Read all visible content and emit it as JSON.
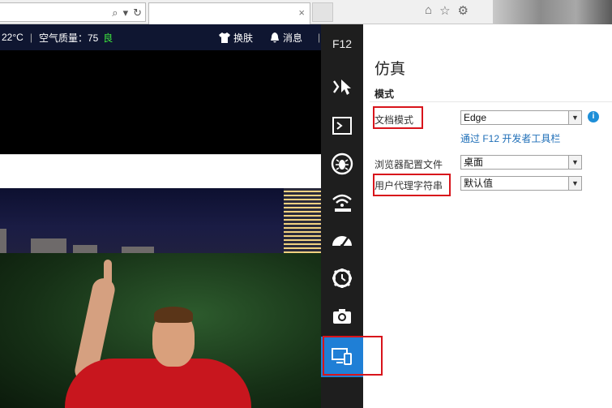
{
  "browser": {
    "tab_close": "×",
    "toolbar_icons": [
      "⌕",
      "▾",
      "↻"
    ],
    "right_icons": [
      "⌂",
      "☆",
      "⚙"
    ]
  },
  "page": {
    "weather": "22°C",
    "separator": "|",
    "air_quality_label": "空气质量：75",
    "air_quality_level": "良",
    "skin_label": "换肤",
    "message_label": "消息",
    "trailing_separator": "|"
  },
  "devtools": {
    "title": "F12",
    "tools": [
      "dom-explorer",
      "console",
      "debugger",
      "network",
      "performance",
      "memory",
      "profiler",
      "emulation"
    ],
    "panel": {
      "title": "仿真",
      "section": "模式",
      "rows": [
        {
          "label": "文档模式",
          "value": "Edge"
        },
        {
          "label": "浏览器配置文件",
          "value": "桌面"
        },
        {
          "label": "用户代理字符串",
          "value": "默认值"
        }
      ],
      "info_symbol": "i",
      "link": "通过 F12 开发者工具栏"
    }
  },
  "colors": {
    "accent": "#1f7fd6",
    "highlight": "#d8141b",
    "rail_bg": "#1e1e1e",
    "good": "#3ee63e"
  }
}
